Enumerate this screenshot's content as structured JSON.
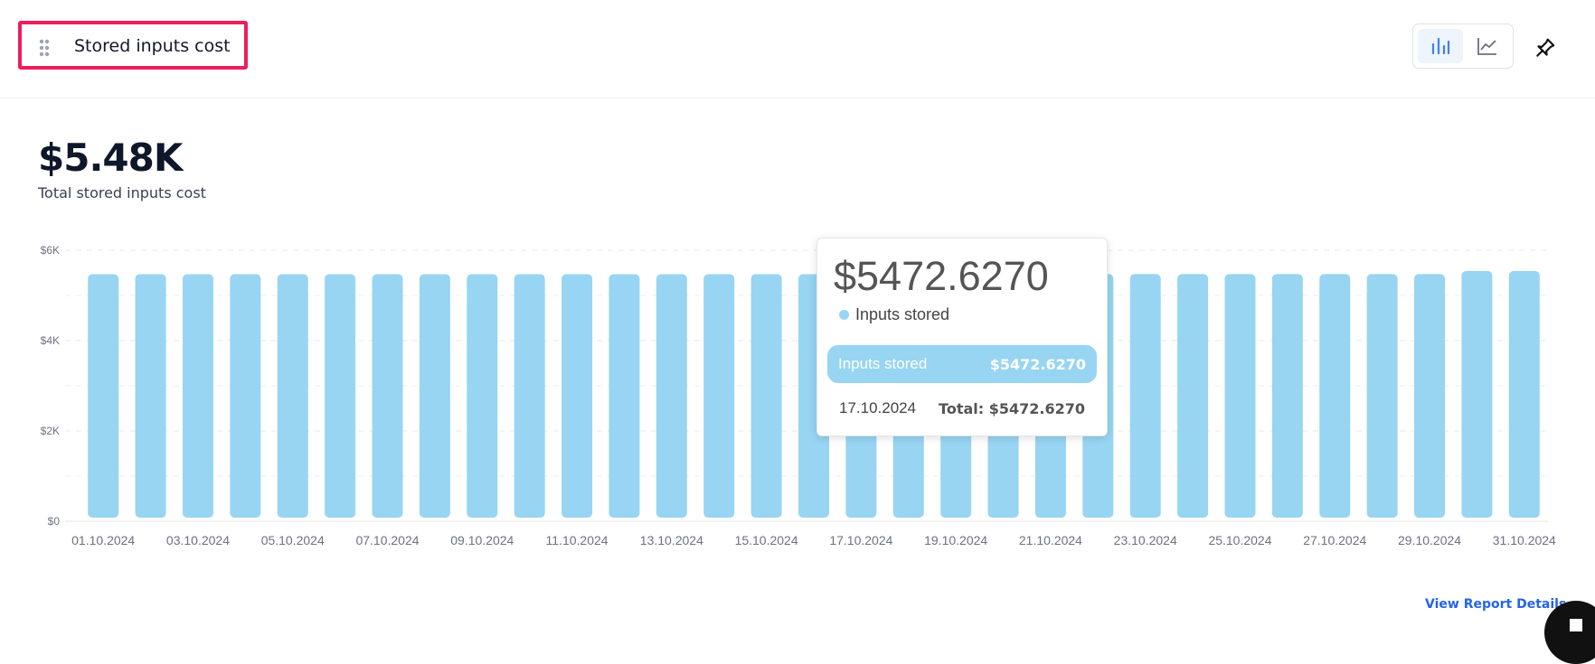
{
  "header": {
    "title": "Stored inputs cost"
  },
  "toolbar": {
    "chart_type_options": [
      "bar-chart-icon",
      "line-chart-icon"
    ],
    "active_chart_type": "bar-chart-icon",
    "pin_icon": "pin-icon"
  },
  "summary": {
    "value": "$5.48K",
    "label": "Total stored inputs cost"
  },
  "colors": {
    "bar": "#97d5f2",
    "accent": "#ec1e5b",
    "link": "#2563eb",
    "active_icon": "#3b82f6",
    "inactive_icon": "#6b7280"
  },
  "chart_data": {
    "type": "bar",
    "categories": [
      "01.10.2024",
      "02.10.2024",
      "03.10.2024",
      "04.10.2024",
      "05.10.2024",
      "06.10.2024",
      "07.10.2024",
      "08.10.2024",
      "09.10.2024",
      "10.10.2024",
      "11.10.2024",
      "12.10.2024",
      "13.10.2024",
      "14.10.2024",
      "15.10.2024",
      "16.10.2024",
      "17.10.2024",
      "18.10.2024",
      "19.10.2024",
      "20.10.2024",
      "21.10.2024",
      "22.10.2024",
      "23.10.2024",
      "24.10.2024",
      "25.10.2024",
      "26.10.2024",
      "27.10.2024",
      "28.10.2024",
      "29.10.2024",
      "30.10.2024",
      "31.10.2024"
    ],
    "x_tick_labels": [
      "01.10.2024",
      "03.10.2024",
      "05.10.2024",
      "07.10.2024",
      "09.10.2024",
      "11.10.2024",
      "13.10.2024",
      "15.10.2024",
      "17.10.2024",
      "19.10.2024",
      "21.10.2024",
      "23.10.2024",
      "25.10.2024",
      "27.10.2024",
      "29.10.2024",
      "31.10.2024"
    ],
    "series": [
      {
        "name": "Inputs stored",
        "values": [
          5470,
          5470,
          5470,
          5470,
          5470,
          5470,
          5470,
          5470,
          5470,
          5470,
          5470,
          5470,
          5470,
          5470,
          5470,
          5470,
          5472.627,
          5472,
          5472,
          5472,
          5472,
          5472,
          5472,
          5472,
          5472,
          5472,
          5472,
          5472,
          5472,
          5540,
          5540
        ]
      }
    ],
    "y_ticks": [
      0,
      2000,
      4000,
      6000
    ],
    "y_tick_labels": [
      "$0",
      "$2K",
      "$4K",
      "$6K"
    ],
    "ylim": [
      0,
      6000
    ],
    "grid": true,
    "tooltip": {
      "value": "$5472.6270",
      "series_name": "Inputs stored",
      "row_label": "Inputs stored",
      "row_value": "$5472.6270",
      "date": "17.10.2024",
      "total": "Total: $5472.6270"
    }
  },
  "footer": {
    "link_label": "View Report Details"
  }
}
